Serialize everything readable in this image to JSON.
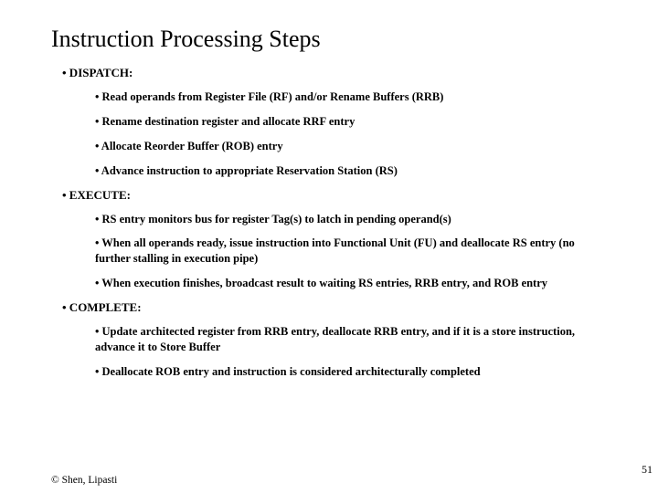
{
  "title": "Instruction Processing Steps",
  "sections": {
    "dispatch": {
      "heading": "• DISPATCH:",
      "items": [
        "• Read operands from Register File (RF) and/or Rename Buffers (RRB)",
        "• Rename destination register and allocate RRF entry",
        "• Allocate Reorder Buffer (ROB) entry",
        "• Advance instruction to appropriate Reservation Station (RS)"
      ]
    },
    "execute": {
      "heading": "• EXECUTE:",
      "items": [
        "• RS entry monitors bus for register Tag(s) to latch in pending operand(s)",
        "• When all operands ready, issue instruction into Functional Unit (FU) and deallocate RS entry (no further stalling in execution pipe)",
        "• When execution finishes, broadcast result to waiting RS entries, RRB entry, and ROB entry"
      ]
    },
    "complete": {
      "heading": "• COMPLETE:",
      "items": [
        "• Update architected register from RRB entry, deallocate RRB entry, and if it is a store instruction, advance it to Store Buffer",
        "• Deallocate ROB entry and instruction is considered architecturally completed"
      ]
    }
  },
  "footer": "© Shen, Lipasti",
  "page_number": "51"
}
